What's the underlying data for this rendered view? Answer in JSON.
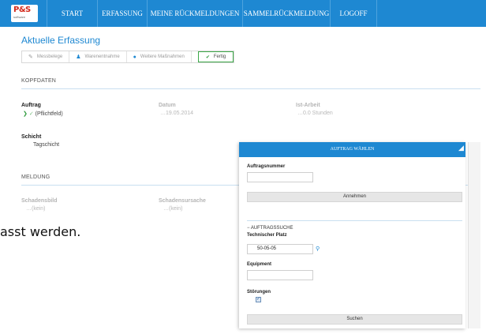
{
  "logo": {
    "text": "P&S",
    "subtext": "software"
  },
  "nav": {
    "items": [
      {
        "label": "START"
      },
      {
        "label": "ERFASSUNG"
      },
      {
        "label": "MEINE RÜCKMELDUNGEN"
      },
      {
        "label": "SAMMELRÜCKMELDUNG"
      },
      {
        "label": "LOGOFF"
      }
    ]
  },
  "page": {
    "title": "Aktuelle Erfassung",
    "wizard": [
      {
        "label": "Messbelege",
        "icon": "pencil-icon"
      },
      {
        "label": "Warenentnahme",
        "icon": "person-icon"
      },
      {
        "label": "Weitere Maßnahmen",
        "icon": "circle-icon"
      },
      {
        "label": "Fertig",
        "icon": "check-icon"
      }
    ]
  },
  "kopfdaten": {
    "section": "KOPFDATEN",
    "auftrag": {
      "label": "Auftrag",
      "value": "(Pflichtfeld)"
    },
    "datum": {
      "label": "Datum",
      "value": "19.05.2014"
    },
    "ist_arbeit": {
      "label": "Ist-Arbeit",
      "value": "0.0 Stunden"
    },
    "schicht": {
      "label": "Schicht",
      "value": "Tagschicht"
    }
  },
  "meldung": {
    "section": "MELDUNG",
    "schadensbild": {
      "label": "Schadensbild",
      "value": "(kein)"
    },
    "schadensursache": {
      "label": "Schadensursache",
      "value": "(kein)"
    }
  },
  "background_text": "asst werden.",
  "modal": {
    "title": "AUFTRAG WÄHLEN",
    "auftragsnummer_label": "Auftragsnummer",
    "auftragsnummer_value": "",
    "annehmen_label": "Annehmen",
    "search_section": "AUFTRAGSSUCHE",
    "technischer_platz_label": "Technischer Platz",
    "technischer_platz_value": "50-05-05",
    "equipment_label": "Equipment",
    "equipment_value": "",
    "stoerungen_label": "Störungen",
    "stoerungen_checked": true,
    "suchen_label": "Suchen"
  },
  "colors": {
    "primary": "#1e88d2",
    "success": "#2e9a3c"
  }
}
